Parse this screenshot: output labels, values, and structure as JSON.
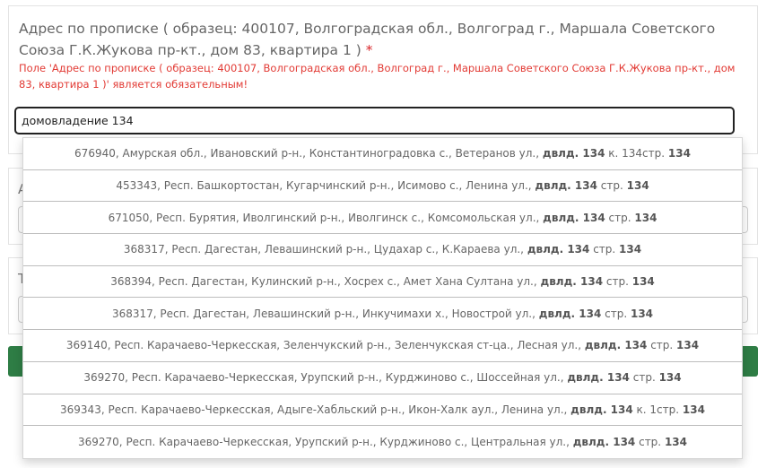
{
  "address_field": {
    "label": "Адрес по прописке ( образец: 400107, Волгоградская обл., Волгоград г., Маршала Советского Союза Г.К.Жукова пр-кт., дом 83, квартира 1 )",
    "required_mark": "*",
    "error": "Поле 'Адрес по прописке ( образец: 400107, Волгоградская обл., Волгоград г., Маршала Советского Союза Г.К.Жукова пр-кт., дом 83, квартира 1 )' является обязательным!",
    "value": "домовладение 134"
  },
  "card2": {
    "label_partial": "А"
  },
  "card3": {
    "label_partial": "Т"
  },
  "suggestions": [
    {
      "prefix": "676940, Амурская обл., Ивановский р-н., Константиноградовка с., Ветеранов ул., ",
      "bold1": "двлд. 134",
      "mid": " к. 134стр. ",
      "bold2": "134"
    },
    {
      "prefix": "453343, Респ. Башкортостан, Кугарчинский р-н., Исимово с., Ленина ул., ",
      "bold1": "двлд. 134",
      "mid": " стр. ",
      "bold2": "134"
    },
    {
      "prefix": "671050, Респ. Бурятия, Иволгинский р-н., Иволгинск с., Комсомольская ул., ",
      "bold1": "двлд. 134",
      "mid": " стр. ",
      "bold2": "134"
    },
    {
      "prefix": "368317, Респ. Дагестан, Левашинский р-н., Цудахар с., К.Караева ул., ",
      "bold1": "двлд. 134",
      "mid": " стр. ",
      "bold2": "134"
    },
    {
      "prefix": "368394, Респ. Дагестан, Кулинский р-н., Хосрех с., Амет Хана Султана ул., ",
      "bold1": "двлд. 134",
      "mid": " стр. ",
      "bold2": "134"
    },
    {
      "prefix": "368317, Респ. Дагестан, Левашинский р-н., Инкучимахи х., Новострой ул., ",
      "bold1": "двлд. 134",
      "mid": " стр. ",
      "bold2": "134"
    },
    {
      "prefix": "369140, Респ. Карачаево-Черкесская, Зеленчукский р-н., Зеленчукская ст-ца., Лесная ул., ",
      "bold1": "двлд. 134",
      "mid": " стр. ",
      "bold2": "134"
    },
    {
      "prefix": "369270, Респ. Карачаево-Черкесская, Урупский р-н., Курджиново с., Шоссейная ул., ",
      "bold1": "двлд. 134",
      "mid": " стр. ",
      "bold2": "134"
    },
    {
      "prefix": "369343, Респ. Карачаево-Черкесская, Адыге-Хабльский р-н., Икон-Халк аул., Ленина ул., ",
      "bold1": "двлд. 134",
      "mid": " к. 1стр. ",
      "bold2": "134"
    },
    {
      "prefix": "369270, Респ. Карачаево-Черкесская, Урупский р-н., Курджиново с., Центральная ул., ",
      "bold1": "двлд. 134",
      "mid": " стр. ",
      "bold2": "134"
    }
  ]
}
